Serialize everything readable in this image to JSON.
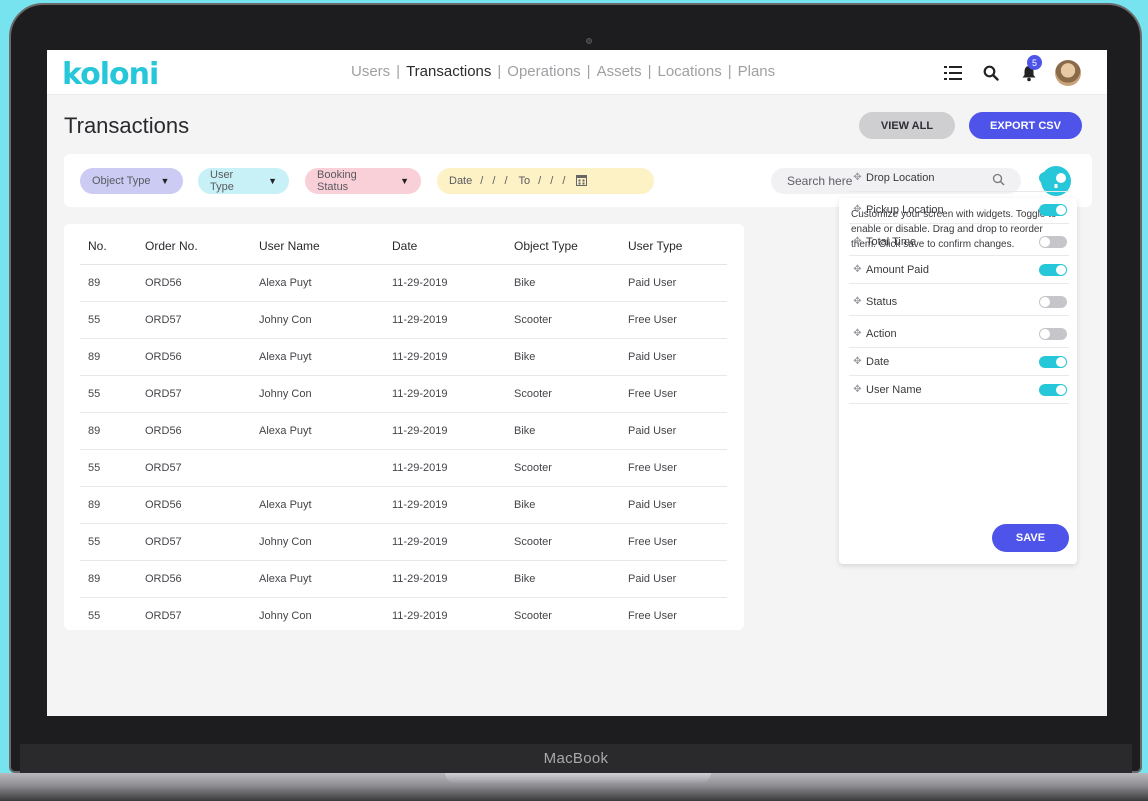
{
  "device": {
    "brand": "MacBook"
  },
  "app": {
    "logo": "koloni"
  },
  "nav": {
    "items": [
      {
        "label": "Users",
        "active": false
      },
      {
        "label": "Transactions",
        "active": true
      },
      {
        "label": "Operations",
        "active": false
      },
      {
        "label": "Assets",
        "active": false
      },
      {
        "label": "Locations",
        "active": false
      },
      {
        "label": "Plans",
        "active": false
      }
    ],
    "separator": "|",
    "icons": [
      "menu-icon",
      "search-icon",
      "bell-icon",
      "avatar"
    ],
    "notification_count": "5"
  },
  "page": {
    "title": "Transactions",
    "view_all_label": "VIEW ALL",
    "export_label": "EXPORT CSV"
  },
  "filters": {
    "object_type": "Object Type",
    "user_type": "User Type",
    "booking_status": "Booking Status",
    "date_from_label": "Date",
    "date_from_value": "/ / /",
    "date_to_label": "To",
    "date_to_value": "/ / /",
    "search_placeholder": "Search here"
  },
  "table": {
    "headers": [
      "No.",
      "Order No.",
      "User Name",
      "Date",
      "Object Type",
      "User Type"
    ],
    "rows": [
      [
        "89",
        "ORD56",
        "Alexa Puyt",
        "11-29-2019",
        "Bike",
        "Paid User"
      ],
      [
        "55",
        "ORD57",
        "Johny Con",
        "11-29-2019",
        "Scooter",
        "Free User"
      ],
      [
        "89",
        "ORD56",
        "Alexa Puyt",
        "11-29-2019",
        "Bike",
        "Paid User"
      ],
      [
        "55",
        "ORD57",
        "Johny Con",
        "11-29-2019",
        "Scooter",
        "Free User"
      ],
      [
        "89",
        "ORD56",
        "Alexa Puyt",
        "11-29-2019",
        "Bike",
        "Paid User"
      ],
      [
        "55",
        "ORD57",
        "",
        "11-29-2019",
        "Scooter",
        "Free User"
      ],
      [
        "89",
        "ORD56",
        "Alexa Puyt",
        "11-29-2019",
        "Bike",
        "Paid User"
      ],
      [
        "55",
        "ORD57",
        "Johny Con",
        "11-29-2019",
        "Scooter",
        "Free User"
      ],
      [
        "89",
        "ORD56",
        "Alexa Puyt",
        "11-29-2019",
        "Bike",
        "Paid User"
      ],
      [
        "55",
        "ORD57",
        "Johny Con",
        "11-29-2019",
        "Scooter",
        "Free User"
      ]
    ]
  },
  "widget_panel": {
    "description": "Customize your screen with widgets. Toggle to enable or disable. Drag and drop to reorder them. Click save to confirm changes.",
    "items": [
      {
        "label": "Drop Location",
        "enabled": true
      },
      {
        "label": "Pickup Location",
        "enabled": true
      },
      {
        "label": "Total Time",
        "enabled": false
      },
      {
        "label": "Amount Paid",
        "enabled": true
      },
      {
        "label": "Status",
        "enabled": false
      },
      {
        "label": "Action",
        "enabled": false
      },
      {
        "label": "Date",
        "enabled": true
      },
      {
        "label": "User Name",
        "enabled": true
      }
    ],
    "save_label": "SAVE"
  },
  "colors": {
    "accent": "#26c7d9",
    "primary": "#4e54e9",
    "background": "#76e3ee"
  }
}
